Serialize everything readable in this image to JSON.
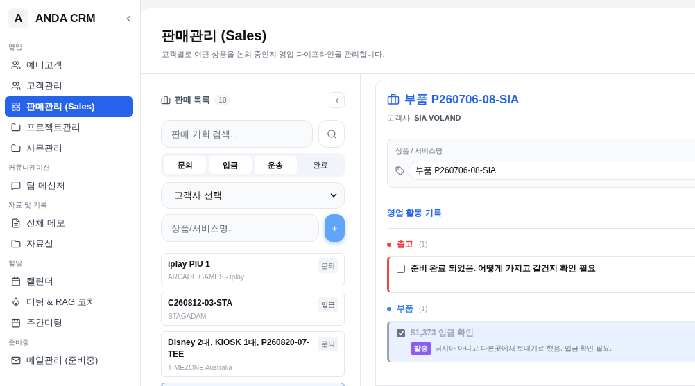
{
  "brand": {
    "logo": "A",
    "name": "ANDA CRM"
  },
  "sidebar": {
    "sections": [
      {
        "title": "영업",
        "items": [
          {
            "label": "예비고객",
            "kind": "users",
            "selected": false
          },
          {
            "label": "고객관리",
            "kind": "users",
            "selected": false
          },
          {
            "label": "판매관리 (Sales)",
            "kind": "grid",
            "selected": true
          },
          {
            "label": "프로젝트관리",
            "kind": "folder",
            "selected": false
          },
          {
            "label": "사무관리",
            "kind": "folder",
            "selected": false
          }
        ]
      },
      {
        "title": "커뮤니케이션",
        "items": [
          {
            "label": "팀 메신저",
            "kind": "chat",
            "selected": false
          }
        ]
      },
      {
        "title": "자료 및 기록",
        "items": [
          {
            "label": "전체 메모",
            "kind": "file",
            "selected": false
          },
          {
            "label": "자료실",
            "kind": "folder",
            "selected": false
          }
        ]
      },
      {
        "title": "할일",
        "items": [
          {
            "label": "캘린더",
            "kind": "calendar",
            "selected": false
          },
          {
            "label": "미팅 & RAG 코치",
            "kind": "mic",
            "selected": false
          },
          {
            "label": "주간미팅",
            "kind": "calendar",
            "selected": false
          }
        ]
      },
      {
        "title": "준비중",
        "items": [
          {
            "label": "메일관리 (준비중)",
            "kind": "mail",
            "selected": false
          }
        ]
      }
    ]
  },
  "page": {
    "title": "판매관리 (Sales)",
    "subtitle": "고객별로 어떤 상품을 논의 중인지 영업 파이프라인을 관리합니다."
  },
  "list": {
    "title": "판매 목록",
    "count": "10",
    "search": {
      "placeholder": "판매 기회 검색..."
    },
    "filters": [
      {
        "label": "문의",
        "selected": true
      },
      {
        "label": "입금",
        "selected": true
      },
      {
        "label": "운송",
        "selected": true
      },
      {
        "label": "완료",
        "selected": false
      }
    ],
    "customer_select": {
      "value": "고객사 선택"
    },
    "new_item": {
      "placeholder": "상품/서비스명...",
      "button": "+"
    },
    "items": [
      {
        "title": "iplay PIU 1",
        "subtitle": "ARCADE GAMES - iplay",
        "status": "문의",
        "selected": false
      },
      {
        "title": "C260812-03-STA",
        "subtitle": "STAGADAM",
        "status": "입금",
        "selected": false
      },
      {
        "title": "Disney 2대, KIOSK 1대, P260820-07-TEE",
        "subtitle": "TIMEZONE Australia",
        "status": "문의",
        "selected": false
      },
      {
        "selected": true
      }
    ]
  },
  "detail": {
    "title": "부품 P260706-08-SIA",
    "customer": "고객사: **SIA VOLAND**",
    "product": {
      "label": "상품 / 서비스명",
      "value": "부품 P260706-08-SIA"
    },
    "activity_title": "영업 활동 기록",
    "groups": [
      {
        "name": "출고",
        "count": "(1)",
        "color": "#ef4444",
        "tasks": [
          {
            "text": "준비 완료 되었음. 어떻게 가지고 갈건지 확인 필요",
            "checked": false
          }
        ]
      },
      {
        "name": "부품",
        "count": "(1)",
        "color": "#3b82f6",
        "tasks": [
          {
            "text": "$1,373 입금 확인",
            "checked": true,
            "tag": "발송",
            "note": "러시아 아니고 다른곳에서 보내기로 했음. 입금 확인 필요."
          }
        ]
      }
    ]
  }
}
